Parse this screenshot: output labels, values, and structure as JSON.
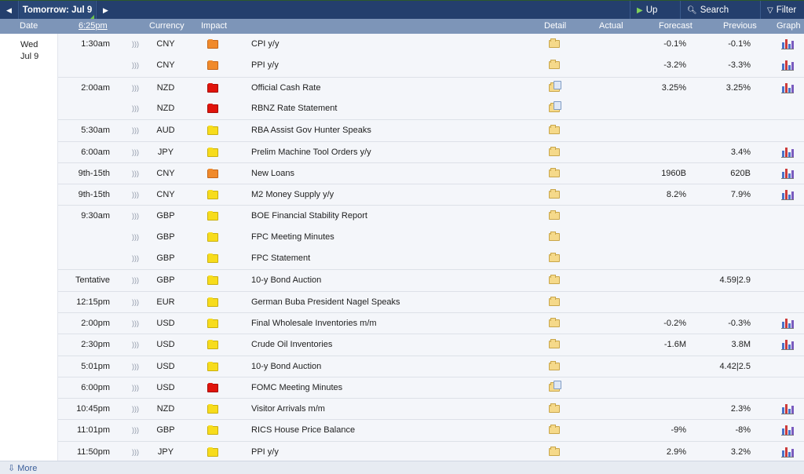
{
  "nav": {
    "prev_arrow": "◀",
    "day_label": "Tomorrow: Jul 9",
    "next_arrow": "▶",
    "up_next_label": "Up Next",
    "search_label": "Search Events",
    "filter_label": "Filter"
  },
  "header": {
    "date": "Date",
    "time": "6:25pm",
    "currency": "Currency",
    "impact": "Impact",
    "detail": "Detail",
    "actual": "Actual",
    "forecast": "Forecast",
    "previous": "Previous",
    "graph": "Graph"
  },
  "day": {
    "weekday": "Wed",
    "date": "Jul 9"
  },
  "impact_colors": {
    "high": "#e0140c",
    "medium": "#f08a2b",
    "low": "#f7dc1c"
  },
  "events": [
    {
      "time": "1:30am",
      "currency": "CNY",
      "impact": "medium",
      "event": "CPI y/y",
      "detail": "folder",
      "actual": "",
      "forecast": "-0.1%",
      "previous": "-0.1%",
      "graph": true
    },
    {
      "time": "",
      "currency": "CNY",
      "impact": "medium",
      "event": "PPI y/y",
      "detail": "folder",
      "actual": "",
      "forecast": "-3.2%",
      "previous": "-3.3%",
      "graph": true
    },
    {
      "time": "2:00am",
      "currency": "NZD",
      "impact": "high",
      "event": "Official Cash Rate",
      "detail": "folder-news",
      "actual": "",
      "forecast": "3.25%",
      "previous": "3.25%",
      "graph": true
    },
    {
      "time": "",
      "currency": "NZD",
      "impact": "high",
      "event": "RBNZ Rate Statement",
      "detail": "folder-news",
      "actual": "",
      "forecast": "",
      "previous": "",
      "graph": false
    },
    {
      "time": "5:30am",
      "currency": "AUD",
      "impact": "low",
      "event": "RBA Assist Gov Hunter Speaks",
      "detail": "folder",
      "actual": "",
      "forecast": "",
      "previous": "",
      "graph": false
    },
    {
      "time": "6:00am",
      "currency": "JPY",
      "impact": "low",
      "event": "Prelim Machine Tool Orders y/y",
      "detail": "folder",
      "actual": "",
      "forecast": "",
      "previous": "3.4%",
      "graph": true
    },
    {
      "time": "9th-15th",
      "currency": "CNY",
      "impact": "medium",
      "event": "New Loans",
      "detail": "folder",
      "actual": "",
      "forecast": "1960B",
      "previous": "620B",
      "graph": true
    },
    {
      "time": "9th-15th",
      "currency": "CNY",
      "impact": "low",
      "event": "M2 Money Supply y/y",
      "detail": "folder",
      "actual": "",
      "forecast": "8.2%",
      "previous": "7.9%",
      "graph": true
    },
    {
      "time": "9:30am",
      "currency": "GBP",
      "impact": "low",
      "event": "BOE Financial Stability Report",
      "detail": "folder",
      "actual": "",
      "forecast": "",
      "previous": "",
      "graph": false
    },
    {
      "time": "",
      "currency": "GBP",
      "impact": "low",
      "event": "FPC Meeting Minutes",
      "detail": "folder",
      "actual": "",
      "forecast": "",
      "previous": "",
      "graph": false
    },
    {
      "time": "",
      "currency": "GBP",
      "impact": "low",
      "event": "FPC Statement",
      "detail": "folder",
      "actual": "",
      "forecast": "",
      "previous": "",
      "graph": false
    },
    {
      "time": "Tentative",
      "currency": "GBP",
      "impact": "low",
      "event": "10-y Bond Auction",
      "detail": "folder",
      "actual": "",
      "forecast": "",
      "previous": "4.59|2.9",
      "graph": false
    },
    {
      "time": "12:15pm",
      "currency": "EUR",
      "impact": "low",
      "event": "German Buba President Nagel Speaks",
      "detail": "folder",
      "actual": "",
      "forecast": "",
      "previous": "",
      "graph": false
    },
    {
      "time": "2:00pm",
      "currency": "USD",
      "impact": "low",
      "event": "Final Wholesale Inventories m/m",
      "detail": "folder",
      "actual": "",
      "forecast": "-0.2%",
      "previous": "-0.3%",
      "graph": true
    },
    {
      "time": "2:30pm",
      "currency": "USD",
      "impact": "low",
      "event": "Crude Oil Inventories",
      "detail": "folder",
      "actual": "",
      "forecast": "-1.6M",
      "previous": "3.8M",
      "graph": true
    },
    {
      "time": "5:01pm",
      "currency": "USD",
      "impact": "low",
      "event": "10-y Bond Auction",
      "detail": "folder",
      "actual": "",
      "forecast": "",
      "previous": "4.42|2.5",
      "graph": false
    },
    {
      "time": "6:00pm",
      "currency": "USD",
      "impact": "high",
      "event": "FOMC Meeting Minutes",
      "detail": "folder-news",
      "actual": "",
      "forecast": "",
      "previous": "",
      "graph": false
    },
    {
      "time": "10:45pm",
      "currency": "NZD",
      "impact": "low",
      "event": "Visitor Arrivals m/m",
      "detail": "folder",
      "actual": "",
      "forecast": "",
      "previous": "2.3%",
      "graph": true
    },
    {
      "time": "11:01pm",
      "currency": "GBP",
      "impact": "low",
      "event": "RICS House Price Balance",
      "detail": "folder",
      "actual": "",
      "forecast": "-9%",
      "previous": "-8%",
      "graph": true
    },
    {
      "time": "11:50pm",
      "currency": "JPY",
      "impact": "low",
      "event": "PPI y/y",
      "detail": "folder",
      "actual": "",
      "forecast": "2.9%",
      "previous": "3.2%",
      "graph": true
    }
  ],
  "footer": {
    "more_label": "⇩ More"
  }
}
